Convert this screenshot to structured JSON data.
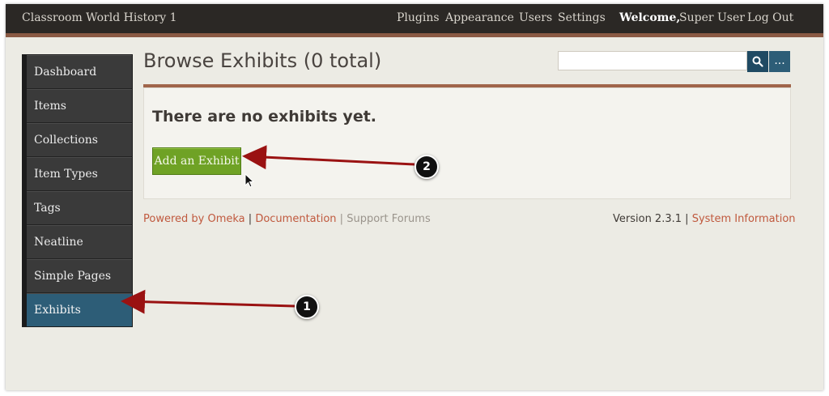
{
  "header": {
    "site_title": "Classroom World History 1",
    "nav": [
      "Plugins",
      "Appearance",
      "Users",
      "Settings"
    ],
    "welcome_label": "Welcome,",
    "user_name": "Super User",
    "logout_label": "Log Out"
  },
  "sidebar": {
    "items": [
      {
        "label": "Dashboard"
      },
      {
        "label": "Items"
      },
      {
        "label": "Collections"
      },
      {
        "label": "Item Types"
      },
      {
        "label": "Tags"
      },
      {
        "label": "Neatline"
      },
      {
        "label": "Simple Pages"
      },
      {
        "label": "Exhibits"
      }
    ],
    "active_label": "Exhibits"
  },
  "main": {
    "title": "Browse Exhibits (0 total)",
    "search": {
      "value": "",
      "placeholder": ""
    },
    "search_button_icon": "search-icon",
    "more_button_label": "...",
    "empty_message": "There are no exhibits yet.",
    "add_button_label": "Add an Exhibit"
  },
  "footer": {
    "powered_by": "Powered by Omeka",
    "documentation": "Documentation",
    "support_forums": "Support Forums",
    "separator": "|",
    "version_label": "Version 2.3.1",
    "system_information": "System Information"
  },
  "callouts": [
    "1",
    "2"
  ],
  "colors": {
    "topbar": "#2b2825",
    "accent_rule": "#a0654a",
    "active_sidebar": "#2d5d77",
    "add_button": "#6fa225",
    "link": "#c0593e",
    "annotation_arrow": "#9a1212"
  }
}
